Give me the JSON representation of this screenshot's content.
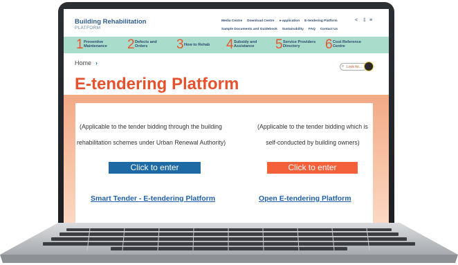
{
  "brand": {
    "title": "Building Rehabilitation",
    "subtitle": "PLATFORM"
  },
  "topnav": {
    "row1": [
      "Media Centre",
      "Download Centre",
      "e-application",
      "E-tendering Platform"
    ],
    "row2": [
      "Sample Documents and Guidebook",
      "Sustainability",
      "FAQ",
      "Contact Us"
    ]
  },
  "icons": {
    "share": "share-icon",
    "font_size": "font-size-icon",
    "language": "language-icon",
    "search": "search-icon"
  },
  "numnav": [
    {
      "num": "1",
      "line1": "Preventive",
      "line2": "Maintenance"
    },
    {
      "num": "2",
      "line1": "Defects and",
      "line2": "Orders"
    },
    {
      "num": "3",
      "line1": "How to Rehab",
      "line2": ""
    },
    {
      "num": "4",
      "line1": "Subsidy and",
      "line2": "Assistance"
    },
    {
      "num": "5",
      "line1": "Service Providers",
      "line2": "Directory"
    },
    {
      "num": "6",
      "line1": "Cost Reference",
      "line2": "Centre"
    }
  ],
  "breadcrumb": {
    "home": "Home",
    "chevron": "›"
  },
  "lookfor": "Look for...",
  "page_title": "E-tendering Platform",
  "left": {
    "desc_line1": "(Applicable to the tender bidding through the building",
    "desc_line2": "rehabilitation schemes under Urban Renewal Authority)",
    "button": "Click to enter",
    "link": "Smart Tender - E-tendering Platform"
  },
  "right": {
    "desc_line1": "(Applicable to the tender bidding which is",
    "desc_line2": "self-conducted by building owners)",
    "button": "Click to enter",
    "link": "Open E-tendering Platform"
  },
  "colors": {
    "accent_orange": "#e5522d",
    "nav_green": "#a9dcca",
    "brand_blue": "#2d5c8f",
    "button_blue": "#1e6aa5",
    "button_red": "#f4603a"
  }
}
